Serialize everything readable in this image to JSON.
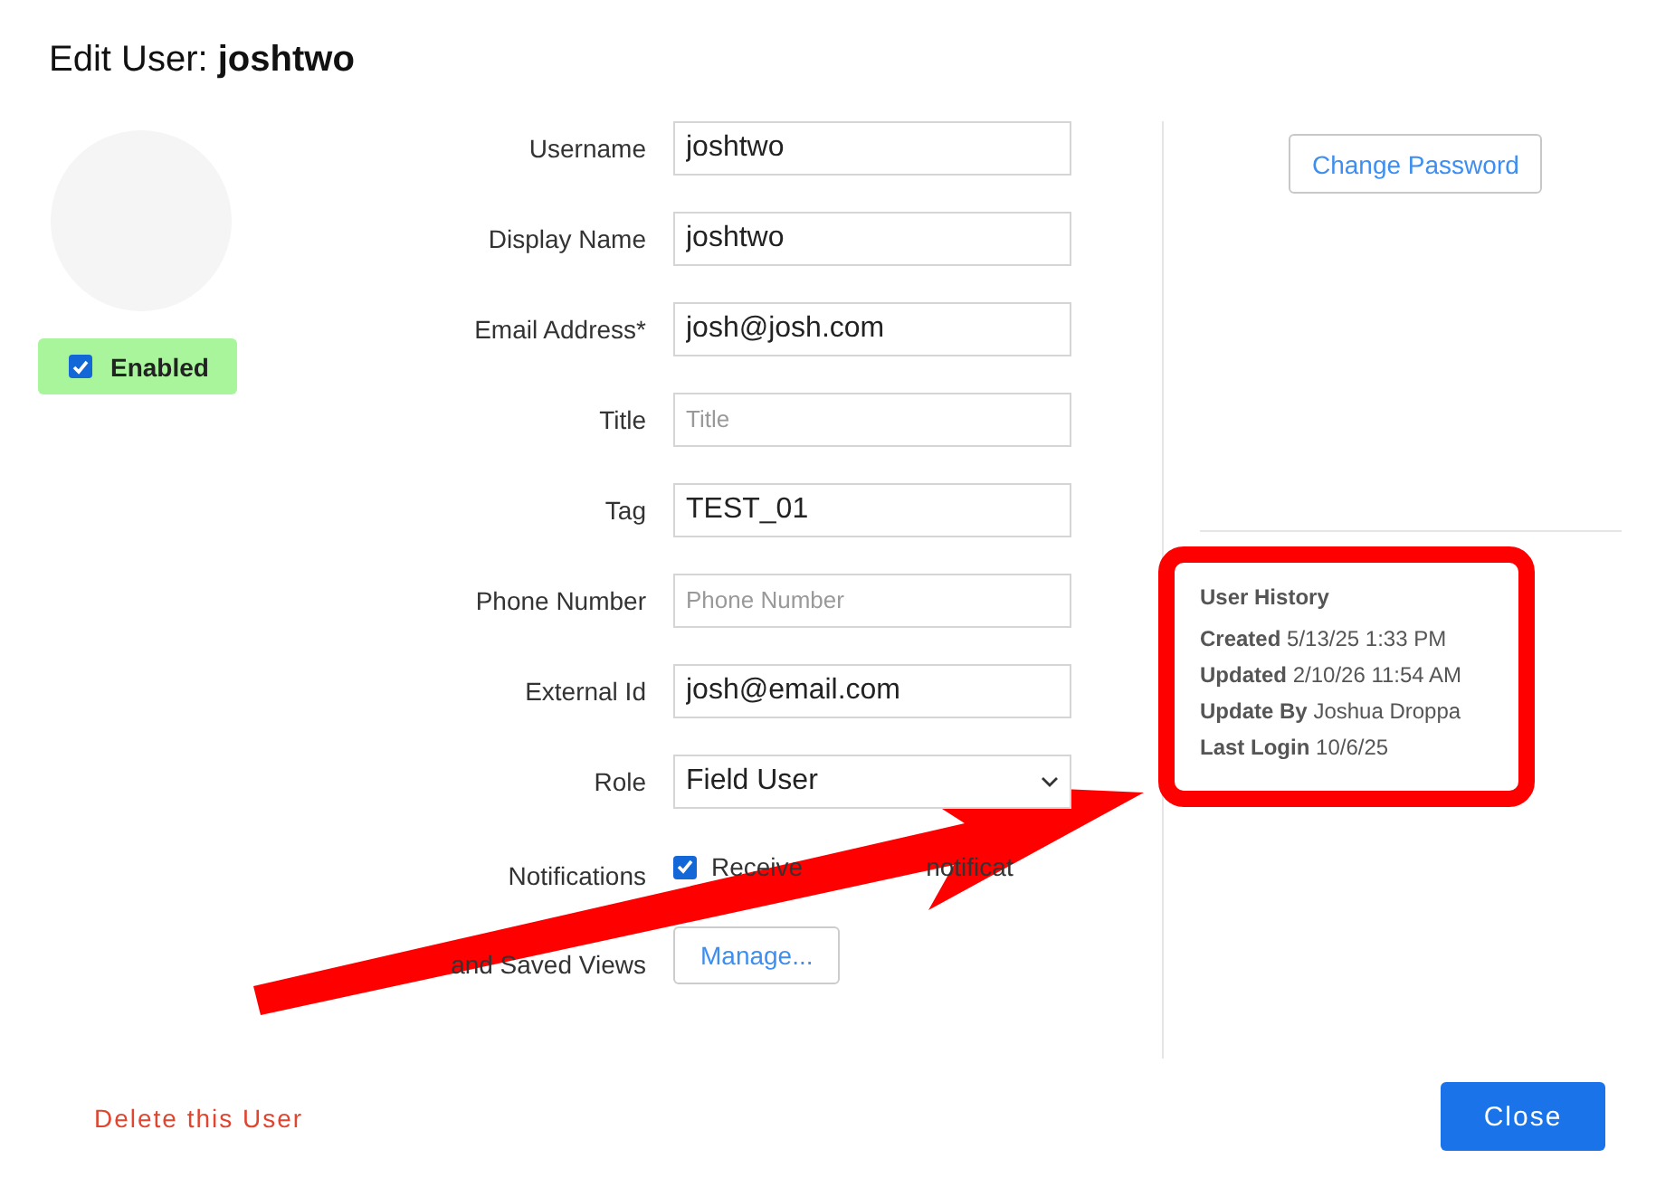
{
  "dialog": {
    "title_prefix": "Edit User:",
    "title_name": "joshtwo"
  },
  "status": {
    "label": "Enabled",
    "checked": true
  },
  "fields": [
    {
      "label": "Username",
      "kind": "text",
      "value": "joshtwo"
    },
    {
      "label": "Display Name",
      "kind": "text",
      "value": "joshtwo"
    },
    {
      "label": "Email Address*",
      "kind": "text",
      "value": "josh@josh.com"
    },
    {
      "label": "Title",
      "kind": "text",
      "placeholder": "Title"
    },
    {
      "label": "Tag",
      "kind": "text",
      "value": "TEST_01"
    },
    {
      "label": "Phone Number",
      "kind": "text",
      "placeholder": "Phone Number"
    },
    {
      "label": "External Id",
      "kind": "text",
      "value": "josh@email.com"
    },
    {
      "label": "Role",
      "kind": "select",
      "value": "Field User"
    },
    {
      "label": "Notifications",
      "kind": "checkbox",
      "checked": true,
      "texts": [
        "Receive",
        "notificat"
      ]
    },
    {
      "label": "and Saved Views",
      "kind": "button",
      "button": "Manage..."
    }
  ],
  "change_password": "Change Password",
  "history": {
    "title": "User History",
    "entries": [
      {
        "label": "Created",
        "value": "5/13/25 1:33 PM"
      },
      {
        "label": "Updated",
        "value": "2/10/26 11:54 AM"
      },
      {
        "label": "Update By",
        "value": "Joshua Droppa"
      },
      {
        "label": "Last Login",
        "value": "10/6/25"
      }
    ]
  },
  "footer": {
    "delete_link": "Delete this User",
    "close_button": "Close"
  }
}
